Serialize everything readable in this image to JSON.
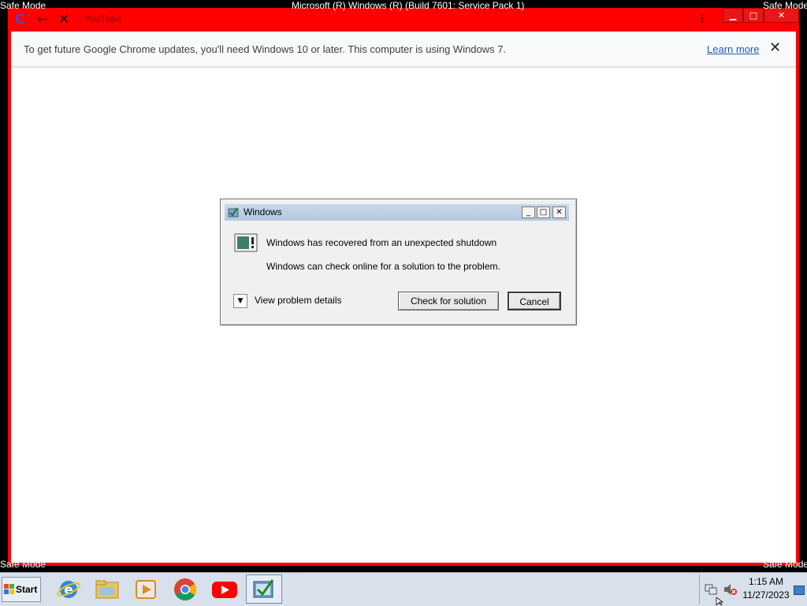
{
  "overlay": {
    "safe_mode_label": "Safe Mode",
    "os_build_text": "Microsoft (R) Windows (R) (Build 7601: Service Pack 1)"
  },
  "browser": {
    "tab_title": "YouTube",
    "infobar": {
      "message": "To get future Google Chrome updates, you'll need Windows 10 or later. This computer is using Windows 7.",
      "link": "Learn more",
      "close": "✕"
    }
  },
  "dialog": {
    "title": "Windows",
    "heading": "Windows has recovered from an unexpected shutdown",
    "body": "Windows can check online for a solution to the problem.",
    "details_label": "View problem details",
    "check_button": "Check for solution",
    "cancel_button": "Cancel"
  },
  "taskbar": {
    "start_label": "Start",
    "time": "1:15 AM",
    "date": "11/27/2023",
    "pinned": [
      "internet-explorer-icon",
      "file-explorer-icon",
      "media-player-icon",
      "chrome-icon",
      "youtube-icon",
      "error-reporting-icon"
    ]
  },
  "colors": {
    "window_frame": "#ff0000",
    "infobar_bg": "#f8f9fa",
    "link": "#1a5fb4",
    "dialog_title_bar": "#b3c8e1",
    "taskbar": "#d7e0eb"
  }
}
